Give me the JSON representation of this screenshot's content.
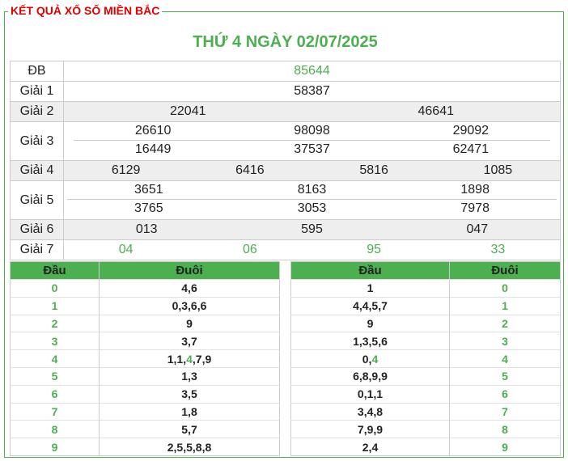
{
  "header": {
    "legend": "KẾT QUẢ XỔ SỐ MIỀN BẮC",
    "title": "THỨ 4 NGÀY 02/07/2025"
  },
  "prizes": {
    "db": {
      "label": "ĐB",
      "values": [
        "85644"
      ]
    },
    "g1": {
      "label": "Giải 1",
      "values": [
        "58387"
      ]
    },
    "g2": {
      "label": "Giải 2",
      "values": [
        "22041",
        "46641"
      ]
    },
    "g3": {
      "label": "Giải 3",
      "rows": [
        [
          "26610",
          "98098",
          "29092"
        ],
        [
          "16449",
          "37537",
          "62471"
        ]
      ]
    },
    "g4": {
      "label": "Giải 4",
      "values": [
        "6129",
        "6416",
        "5816",
        "1085"
      ]
    },
    "g5": {
      "label": "Giải 5",
      "rows": [
        [
          "3651",
          "8163",
          "1898"
        ],
        [
          "3765",
          "3053",
          "7978"
        ]
      ]
    },
    "g6": {
      "label": "Giải 6",
      "values": [
        "013",
        "595",
        "047"
      ]
    },
    "g7": {
      "label": "Giải 7",
      "values": [
        "04",
        "06",
        "95",
        "33"
      ]
    }
  },
  "dau_table": {
    "head_label": "Đầu",
    "tail_label": "Đuôi",
    "rows": [
      {
        "dau": "0",
        "duoi": "4,6"
      },
      {
        "dau": "1",
        "duoi": "0,3,6,6"
      },
      {
        "dau": "2",
        "duoi": "9"
      },
      {
        "dau": "3",
        "duoi": "3,7"
      },
      {
        "dau": "4",
        "duoi_pre": "1,1,",
        "duoi_hl": "4",
        "duoi_post": ",7,9"
      },
      {
        "dau": "5",
        "duoi": "1,3"
      },
      {
        "dau": "6",
        "duoi": "3,5"
      },
      {
        "dau": "7",
        "duoi": "1,8"
      },
      {
        "dau": "8",
        "duoi": "5,7"
      },
      {
        "dau": "9",
        "duoi": "2,5,5,8,8"
      }
    ]
  },
  "duoi_table": {
    "head_label": "Đầu",
    "tail_label": "Đuôi",
    "rows": [
      {
        "dau": "1",
        "duoi": "0"
      },
      {
        "dau": "4,4,5,7",
        "duoi": "1"
      },
      {
        "dau": "9",
        "duoi": "2"
      },
      {
        "dau": "1,3,5,6",
        "duoi": "3"
      },
      {
        "dau_pre": "0,",
        "dau_hl": "4",
        "duoi": "4"
      },
      {
        "dau": "6,8,9,9",
        "duoi": "5"
      },
      {
        "dau": "0,1,1",
        "duoi": "6"
      },
      {
        "dau": "3,4,8",
        "duoi": "7"
      },
      {
        "dau": "7,9,9",
        "duoi": "8"
      },
      {
        "dau": "2,4",
        "duoi": "9"
      }
    ]
  },
  "colors": {
    "accent": "#4caf50",
    "legend_red": "#e00000",
    "row_gray": "#eeeeee"
  }
}
